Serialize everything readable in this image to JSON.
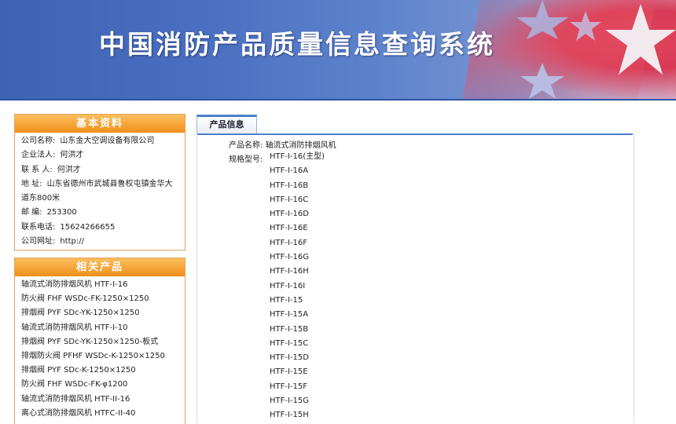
{
  "header": {
    "title": "中国消防产品质量信息查询系统"
  },
  "basic_info": {
    "heading": "基本资料",
    "fields": [
      {
        "label": "公司名称:",
        "value": "山东金大空调设备有限公司"
      },
      {
        "label": "企业法人:",
        "value": "何洪才"
      },
      {
        "label": "联 系 人:",
        "value": "何洪才"
      },
      {
        "label": "地  址:",
        "value": "山东省德州市武城县鲁权屯镇金华大道东800米"
      },
      {
        "label": "邮  编:",
        "value": "253300"
      },
      {
        "label": "联系电话:",
        "value": "15624266655"
      },
      {
        "label": "公司网址:",
        "value": "http://"
      }
    ]
  },
  "related_products": {
    "heading": "相关产品",
    "items": [
      "轴流式消防排烟风机 HTF-I-16",
      "防火阀 FHF WSDc-FK-1250×1250",
      "排烟阀 PYF SDc-YK-1250×1250",
      "轴流式消防排烟风机 HTF-I-10",
      "排烟阀 PYF SDc-YK-1250×1250-板式",
      "排烟防火阀 PFHF WSDc-K-1250×1250",
      "排烟阀 PYF SDc-K-1250×1250",
      "防火阀 FHF WSDc-FK-φ1200",
      "轴流式消防排烟风机 HTF-II-16",
      "离心式消防排烟风机 HTFC-II-40"
    ]
  },
  "product_info": {
    "tab_label": "产品信息",
    "name_label": "产品名称:",
    "name_value": "轴流式消防排烟风机",
    "model_label": "规格型号:",
    "models": [
      "HTF-I-16(主型)",
      "HTF-I-16A",
      "HTF-I-16B",
      "HTF-I-16C",
      "HTF-I-16D",
      "HTF-I-16E",
      "HTF-I-16F",
      "HTF-I-16G",
      "HTF-I-16H",
      "HTF-I-16I",
      "HTF-I-15",
      "HTF-I-15A",
      "HTF-I-15B",
      "HTF-I-15C",
      "HTF-I-15D",
      "HTF-I-15E",
      "HTF-I-15F",
      "HTF-I-15G",
      "HTF-I-15H"
    ]
  }
}
